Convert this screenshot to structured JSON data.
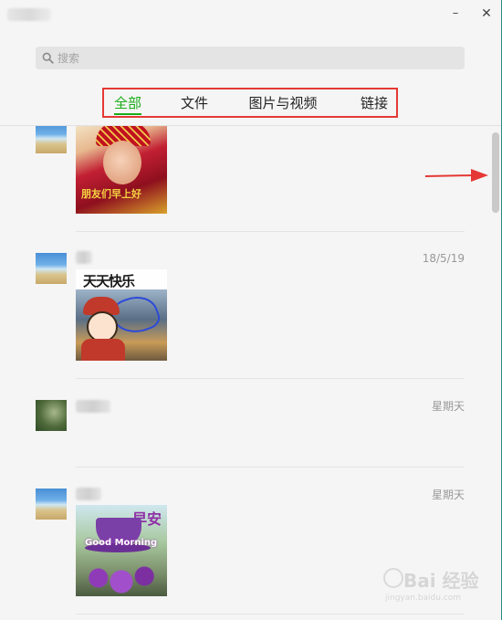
{
  "window": {
    "minimize_glyph": "–",
    "close_glyph": "✕"
  },
  "search": {
    "placeholder": "搜索",
    "icon": "search-icon"
  },
  "tabs": [
    {
      "label": "全部",
      "active": true
    },
    {
      "label": "文件",
      "active": false
    },
    {
      "label": "图片与视频",
      "active": false
    },
    {
      "label": "链接",
      "active": false
    }
  ],
  "colors": {
    "accent_green": "#1aad19",
    "highlight_red": "#e53935"
  },
  "items": [
    {
      "time": "",
      "avatar": "beach-avatar",
      "image_caption": "朋友们早上好"
    },
    {
      "time": "18/5/19",
      "avatar": "beach-avatar",
      "image_caption": "天天快乐"
    },
    {
      "time": "星期天",
      "avatar": "landscape-avatar",
      "image_caption": ""
    },
    {
      "time": "星期天",
      "avatar": "beach-avatar",
      "image_caption": "早安",
      "image_subcaption": "Good Morning"
    }
  ],
  "watermark": {
    "text": "Bai 经验",
    "url": "jingyan.baidu.com"
  }
}
